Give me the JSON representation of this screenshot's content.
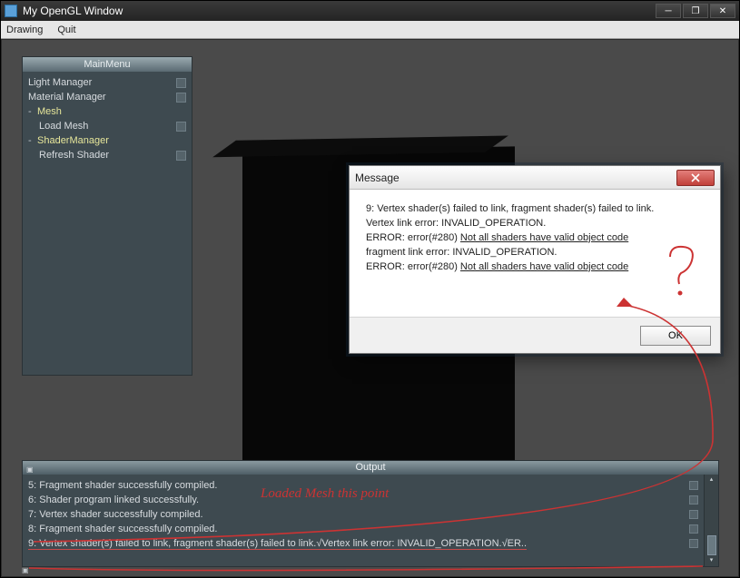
{
  "window": {
    "title": "My OpenGL Window",
    "menu": {
      "drawing": "Drawing",
      "quit": "Quit"
    }
  },
  "mainmenu": {
    "title": "MainMenu",
    "items": [
      {
        "label": "Light Manager",
        "checkbox": true
      },
      {
        "label": "Material Manager",
        "checkbox": true
      },
      {
        "label": "Mesh",
        "expandable": true,
        "highlighted": true
      },
      {
        "label": "Load Mesh",
        "indent": true,
        "checkbox": true
      },
      {
        "label": "ShaderManager",
        "expandable": true,
        "highlighted": true
      },
      {
        "label": "Refresh Shader",
        "indent": true,
        "checkbox": true
      }
    ]
  },
  "dialog": {
    "title": "Message",
    "lines": {
      "l1a": "9: Vertex shader(s) failed to link, fragment shader(s) failed to link.",
      "l2": "Vertex link error: INVALID_OPERATION.",
      "l3a": "ERROR: error(#280) ",
      "l3b": "Not all shaders have valid object code",
      "l4": "fragment link error: INVALID_OPERATION.",
      "l5a": "ERROR: error(#280) ",
      "l5b": "Not all shaders have valid object code"
    },
    "ok": "OK"
  },
  "output": {
    "title": "Output",
    "lines": [
      "5: Fragment shader successfully compiled.",
      "6: Shader program linked successfully.",
      "7: Vertex shader successfully compiled.",
      "8: Fragment shader successfully compiled.",
      "9: Vertex shader(s) failed to link, fragment shader(s) failed to link.√Vertex link error: INVALID_OPERATION.√ER.."
    ]
  },
  "annotations": {
    "question": "?",
    "loaded": "Loaded Mesh this point"
  },
  "colors": {
    "panel_bg": "#3e4a50",
    "viewport_bg": "#4a4a4a",
    "highlight_text": "#e6e69a",
    "annotation": "#c33333"
  }
}
